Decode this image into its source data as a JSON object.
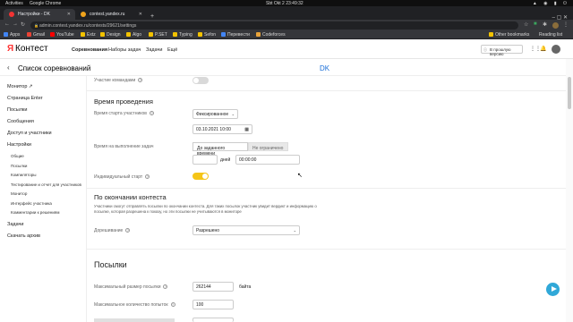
{
  "os": {
    "activities_label": "Activities",
    "app_name": "Google Chrome",
    "clock": "Sbt Okt 2  23:49:32",
    "tray": "▲ ◉ ▮ ⏻"
  },
  "browser": {
    "tabs": [
      {
        "title": "Настройки - DK",
        "favicon_color": "#f33333",
        "active": true
      },
      {
        "title": "contest.yandex.ru",
        "favicon_color": "#f0a31c",
        "active": false
      }
    ],
    "new_tab": "+",
    "window_controls": "–  ▢  ✕",
    "url": "admin.contest.yandex.ru/contests/29621/settings",
    "bookmarks": [
      {
        "label": "Apps",
        "color": "#4285f4"
      },
      {
        "label": "Gmail",
        "color": "#ea4335"
      },
      {
        "label": "YouTube",
        "color": "#ff0000"
      },
      {
        "label": "Extz",
        "color": "#f2c200"
      },
      {
        "label": "Design",
        "color": "#f2c200"
      },
      {
        "label": "Algo",
        "color": "#f2c200"
      },
      {
        "label": "P.SET",
        "color": "#f2c200"
      },
      {
        "label": "Typing",
        "color": "#f2c200"
      },
      {
        "label": "Sefon",
        "color": "#f2c200"
      },
      {
        "label": "Перевести",
        "color": "#4285f4"
      },
      {
        "label": "Codeforces",
        "color": "#e8a33a"
      }
    ],
    "other_bookmarks": "Other bookmarks",
    "reading_list": "Reading list"
  },
  "site": {
    "logo_ya": "Я",
    "logo_name": "Контест",
    "nav": [
      "Соревнования",
      "Наборы задач",
      "Задачи",
      "Ещё"
    ],
    "old_version": "В прошлую версию"
  },
  "page": {
    "title": "Список соревнований",
    "contest_name": "DK"
  },
  "sidebar": {
    "items": [
      "Монитор",
      "Страница Enter",
      "Посылки",
      "Сообщения",
      "Доступ и участники",
      "Настройки"
    ],
    "subitems": [
      "Общие",
      "Посылки",
      "Компиляторы",
      "Тестирование и отчет для участников",
      "Монитор",
      "Интерфейс участника",
      "Комментарии к решениям"
    ],
    "bottom": [
      "Задачи",
      "Скачать архив"
    ]
  },
  "form": {
    "team_participants": "Участие командами",
    "section_time": "Время проведения",
    "start_time_label": "Время старта участников",
    "start_time_mode": "Фиксированное",
    "start_date": "03.10.2021 10:00",
    "duration_label": "Время на выполнение задач",
    "duration_modes": [
      "До заданного времени",
      "Не ограничено"
    ],
    "days_label": "дней",
    "duration_time": "00:00:00",
    "individual_start": "Индивидуальный старт",
    "section_after": "По окончании контеста",
    "after_note": "Участники смогут отправлять посылки по окончании контеста. Для таких посылок участник увидит вердикт и информацию о посылке, которая разрешена к показу, но эти посылки не учитываются в мониторе",
    "upsolving_label": "Дорешивание",
    "upsolving_value": "Разрешено",
    "section_submissions": "Посылки",
    "max_size_label": "Максимальный размер посылки",
    "max_size_value": "262144",
    "max_size_unit": "байта",
    "max_attempts_label": "Максимальное количество попыток",
    "max_attempts_value": "100"
  },
  "colors": {
    "accent_toggle": "#f5c518",
    "toggle_off": "#d9d9d9",
    "link_blue": "#1a6ed8",
    "brand_red": "#f33333"
  }
}
